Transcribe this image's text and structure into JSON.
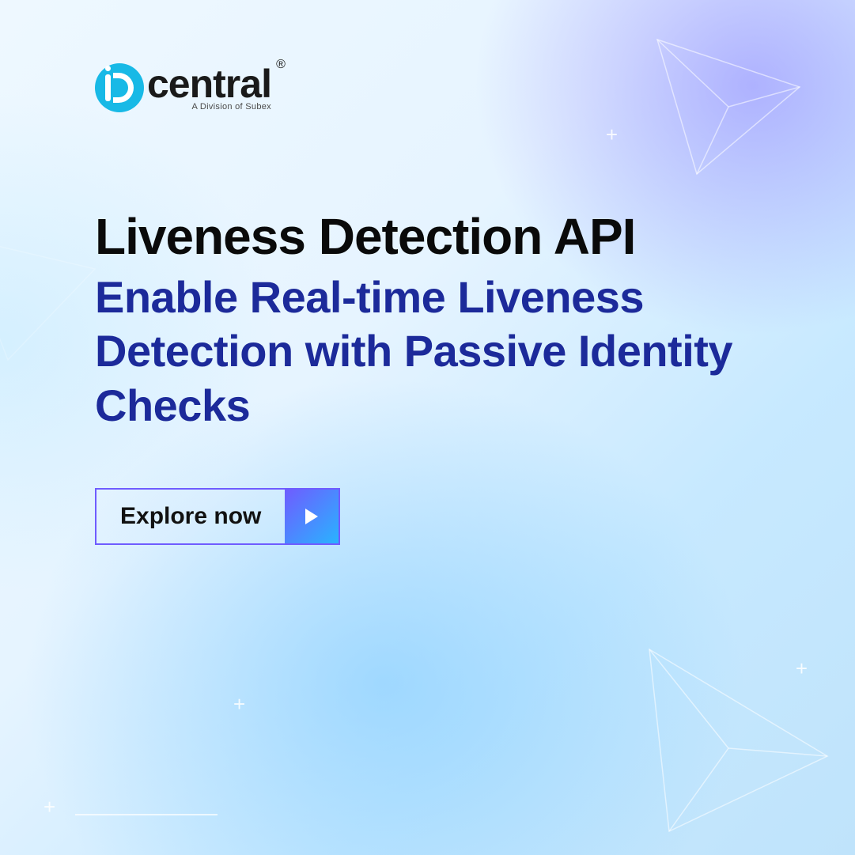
{
  "logo": {
    "word": "central",
    "registered": "®",
    "subline": "A Division of Subex"
  },
  "hero": {
    "title": "Liveness Detection API",
    "subtitle": "Enable Real-time Liveness Detection with Passive Identity Checks"
  },
  "cta": {
    "label": "Explore now"
  }
}
